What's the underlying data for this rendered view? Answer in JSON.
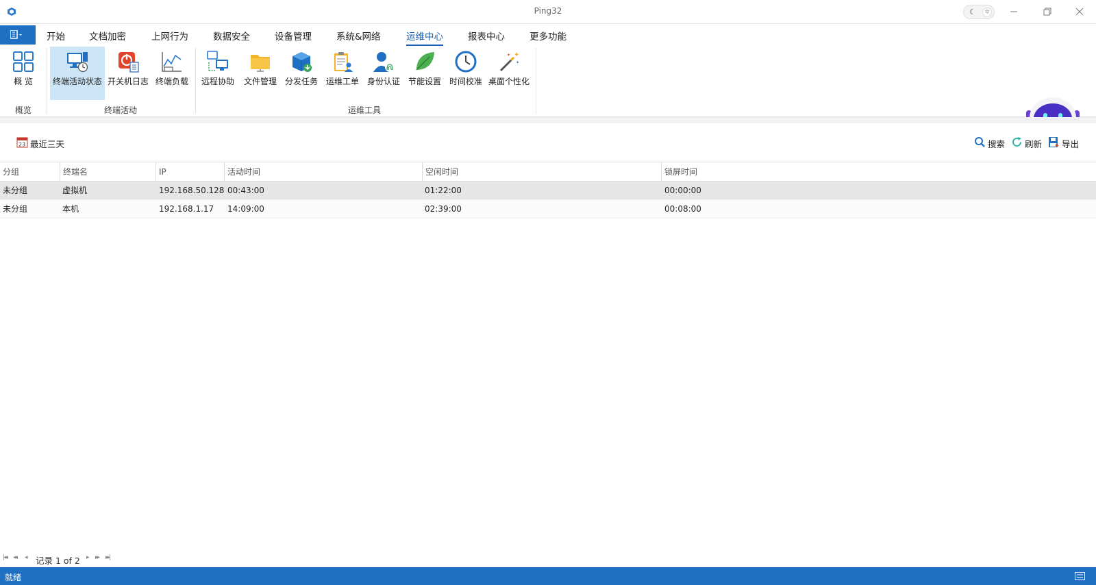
{
  "window": {
    "title": "Ping32"
  },
  "menu": {
    "tabs": [
      "开始",
      "文档加密",
      "上网行为",
      "数据安全",
      "设备管理",
      "系统&网络",
      "运维中心",
      "报表中心",
      "更多功能"
    ],
    "active": "运维中心"
  },
  "ribbon": {
    "overview": {
      "button": "概 览",
      "group": "概览"
    },
    "terminal_activity": {
      "buttons": [
        "终端活动状态",
        "开关机日志",
        "终端负载"
      ],
      "group": "终端活动"
    },
    "ops_tools": {
      "buttons": [
        "远程协助",
        "文件管理",
        "分发任务",
        "运维工单",
        "身份认证",
        "节能设置",
        "时间校准",
        "桌面个性化"
      ],
      "group": "运维工具"
    }
  },
  "toolbar": {
    "date_range": "最近三天",
    "calendar_day": "23",
    "search": "搜索",
    "refresh": "刷新",
    "export": "导出"
  },
  "grid": {
    "columns": [
      "分组",
      "终端名",
      "IP",
      "活动时间",
      "空闲时间",
      "锁屏时间"
    ],
    "rows": [
      [
        "未分组",
        "虚拟机",
        "192.168.50.128",
        "00:43:00",
        "01:22:00",
        "00:00:00"
      ],
      [
        "未分组",
        "本机",
        "192.168.1.17",
        "14:09:00",
        "02:39:00",
        "00:08:00"
      ]
    ]
  },
  "pager": {
    "text": "记录 1 of 2"
  },
  "status": {
    "text": "就绪"
  },
  "colors": {
    "accent": "#1f6fc3",
    "selected_ribbon": "#cde6f7",
    "active_tab": "#1a5fb4",
    "selected_row": "#e6e6e6"
  }
}
